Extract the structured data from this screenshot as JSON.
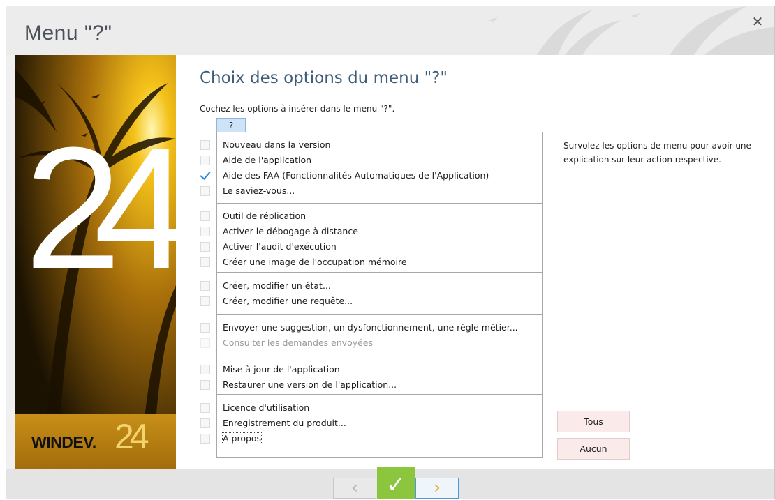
{
  "window": {
    "title": "Menu \"?\"",
    "close_glyph": "✕"
  },
  "sidebar": {
    "big_number": "24",
    "brand_name": "WINDEV.",
    "brand_version": "24"
  },
  "page": {
    "heading": "Choix des options du menu \"?\"",
    "instruction": "Cochez les options à insérer dans le menu \"?\".",
    "menu_tab": "?",
    "hint": "Survolez les options de menu pour avoir une explication sur leur action respective."
  },
  "groups": [
    {
      "options": [
        {
          "label": "Nouveau dans la version",
          "checked": false,
          "disabled": false
        },
        {
          "label": "Aide de l'application",
          "checked": false,
          "disabled": false
        },
        {
          "label": "Aide des FAA (Fonctionnalités Automatiques de l'Application)",
          "checked": true,
          "disabled": false
        },
        {
          "label": "Le saviez-vous...",
          "checked": false,
          "disabled": false
        }
      ]
    },
    {
      "options": [
        {
          "label": "Outil de réplication",
          "checked": false,
          "disabled": false
        },
        {
          "label": "Activer le débogage à distance",
          "checked": false,
          "disabled": false
        },
        {
          "label": "Activer l'audit d'exécution",
          "checked": false,
          "disabled": false
        },
        {
          "label": "Créer une image de l'occupation mémoire",
          "checked": false,
          "disabled": false
        }
      ]
    },
    {
      "options": [
        {
          "label": "Créer, modifier un état...",
          "checked": false,
          "disabled": false
        },
        {
          "label": "Créer, modifier une requête...",
          "checked": false,
          "disabled": false
        }
      ]
    },
    {
      "options": [
        {
          "label": "Envoyer une suggestion, un dysfonctionnement, une règle métier...",
          "checked": false,
          "disabled": false
        },
        {
          "label": "Consulter les demandes envoyées",
          "checked": false,
          "disabled": true
        }
      ]
    },
    {
      "options": [
        {
          "label": "Mise à jour de l'application",
          "checked": false,
          "disabled": false
        },
        {
          "label": "Restaurer une version de l'application...",
          "checked": false,
          "disabled": false
        }
      ]
    },
    {
      "options": [
        {
          "label": "Licence d'utilisation",
          "checked": false,
          "disabled": false
        },
        {
          "label": "Enregistrement du produit...",
          "checked": false,
          "disabled": false
        },
        {
          "label": "A propos",
          "checked": false,
          "disabled": false,
          "focused": true
        }
      ]
    }
  ],
  "buttons": {
    "all": "Tous",
    "none": "Aucun"
  },
  "nav": {
    "prev_glyph": "‹",
    "ok_glyph": "✓",
    "next_glyph": "›"
  },
  "colors": {
    "accent_blue": "#2c88d9",
    "ok_green": "#8cc63f",
    "next_arrow": "#f0a020"
  }
}
